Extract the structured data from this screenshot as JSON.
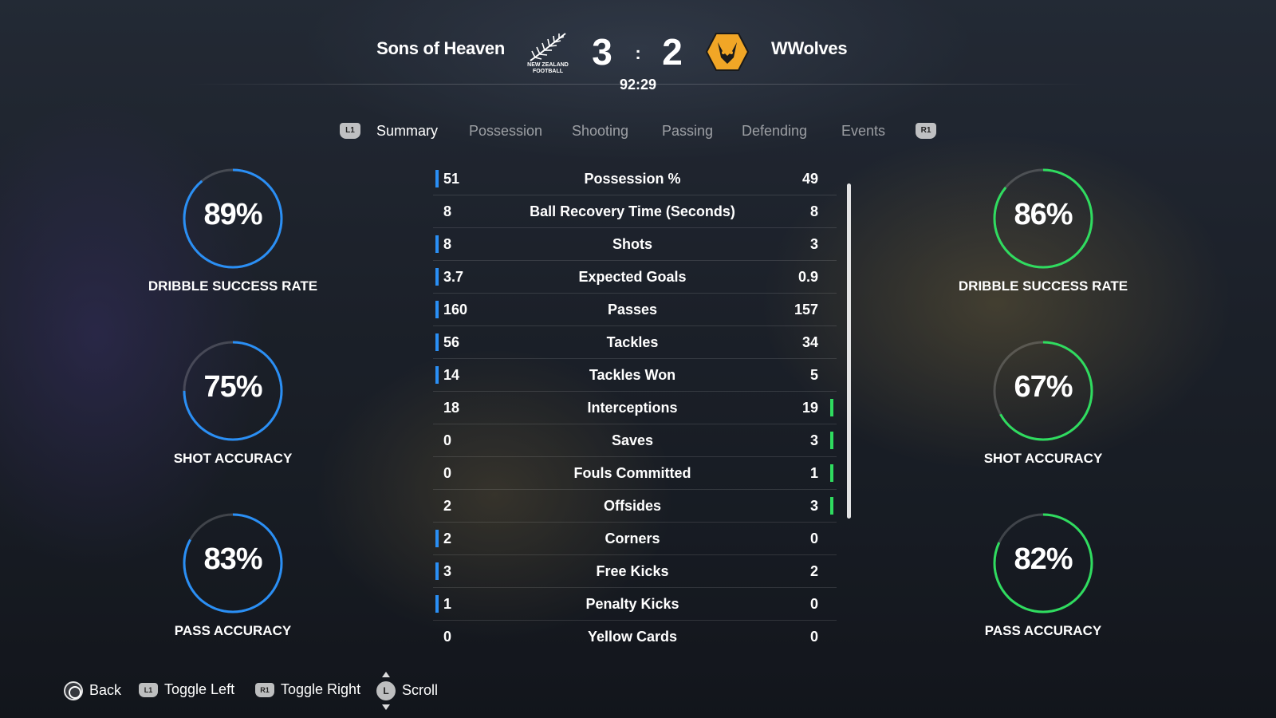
{
  "match": {
    "home_team": "Sons of Heaven",
    "away_team": "WWolves",
    "home_score": "3",
    "separator": ":",
    "away_score": "2",
    "clock": "92:29",
    "home_crest_text": "NEW ZEALAND FOOTBALL",
    "home_crest_icon": "fern-icon",
    "away_crest_icon": "wolf-icon"
  },
  "tabs": {
    "left_bumper": "L1",
    "right_bumper": "R1",
    "items": [
      {
        "label": "Summary",
        "active": true
      },
      {
        "label": "Possession",
        "active": false
      },
      {
        "label": "Shooting",
        "active": false
      },
      {
        "label": "Passing",
        "active": false
      },
      {
        "label": "Defending",
        "active": false
      },
      {
        "label": "Events",
        "active": false
      }
    ]
  },
  "colors": {
    "home_accent": "#2a8ff5",
    "away_accent": "#2fdc5f"
  },
  "home_rings": [
    {
      "value": "89%",
      "label": "DRIBBLE SUCCESS RATE",
      "fraction": 0.89
    },
    {
      "value": "75%",
      "label": "SHOT ACCURACY",
      "fraction": 0.75
    },
    {
      "value": "83%",
      "label": "PASS ACCURACY",
      "fraction": 0.83
    }
  ],
  "away_rings": [
    {
      "value": "86%",
      "label": "DRIBBLE SUCCESS RATE",
      "fraction": 0.86
    },
    {
      "value": "67%",
      "label": "SHOT ACCURACY",
      "fraction": 0.67
    },
    {
      "value": "82%",
      "label": "PASS ACCURACY",
      "fraction": 0.82
    }
  ],
  "stats": [
    {
      "label": "Possession %",
      "home": "51",
      "away": "49",
      "leader": "home"
    },
    {
      "label": "Ball Recovery Time (Seconds)",
      "home": "8",
      "away": "8",
      "leader": "none"
    },
    {
      "label": "Shots",
      "home": "8",
      "away": "3",
      "leader": "home"
    },
    {
      "label": "Expected Goals",
      "home": "3.7",
      "away": "0.9",
      "leader": "home"
    },
    {
      "label": "Passes",
      "home": "160",
      "away": "157",
      "leader": "home"
    },
    {
      "label": "Tackles",
      "home": "56",
      "away": "34",
      "leader": "home"
    },
    {
      "label": "Tackles Won",
      "home": "14",
      "away": "5",
      "leader": "home"
    },
    {
      "label": "Interceptions",
      "home": "18",
      "away": "19",
      "leader": "away"
    },
    {
      "label": "Saves",
      "home": "0",
      "away": "3",
      "leader": "away"
    },
    {
      "label": "Fouls Committed",
      "home": "0",
      "away": "1",
      "leader": "away"
    },
    {
      "label": "Offsides",
      "home": "2",
      "away": "3",
      "leader": "away"
    },
    {
      "label": "Corners",
      "home": "2",
      "away": "0",
      "leader": "home"
    },
    {
      "label": "Free Kicks",
      "home": "3",
      "away": "2",
      "leader": "home"
    },
    {
      "label": "Penalty Kicks",
      "home": "1",
      "away": "0",
      "leader": "home"
    },
    {
      "label": "Yellow Cards",
      "home": "0",
      "away": "0",
      "leader": "none"
    }
  ],
  "footer": {
    "back_label": "Back",
    "toggle_left_label": "Toggle Left",
    "toggle_left_button": "L1",
    "toggle_right_label": "Toggle Right",
    "toggle_right_button": "R1",
    "scroll_label": "Scroll",
    "scroll_button": "L"
  }
}
